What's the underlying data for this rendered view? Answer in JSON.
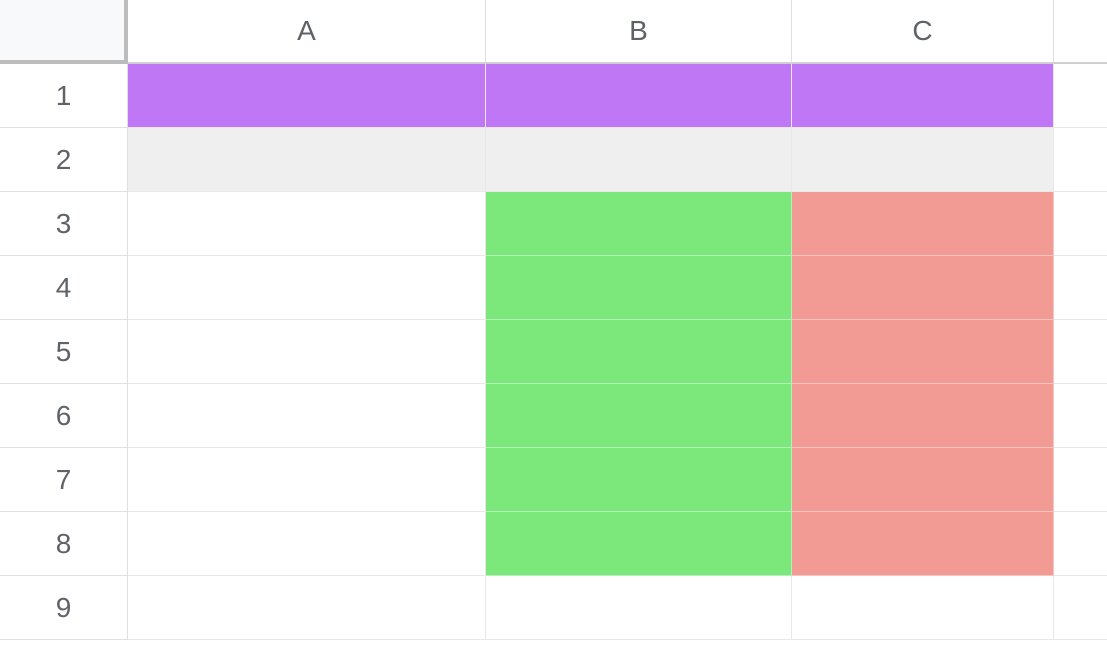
{
  "columns": [
    "A",
    "B",
    "C"
  ],
  "rows": [
    "1",
    "2",
    "3",
    "4",
    "5",
    "6",
    "7",
    "8",
    "9"
  ],
  "fills": {
    "purple": "#bf77f6",
    "gray": "#efefef",
    "green": "#7ce87c",
    "red": "#f29b94"
  },
  "cell_fills": [
    {
      "row": 1,
      "cols": [
        "A",
        "B",
        "C"
      ],
      "fill": "purple"
    },
    {
      "row": 2,
      "cols": [
        "A",
        "B",
        "C"
      ],
      "fill": "gray"
    },
    {
      "row": 3,
      "cols": [
        "B"
      ],
      "fill": "green"
    },
    {
      "row": 3,
      "cols": [
        "C"
      ],
      "fill": "red"
    },
    {
      "row": 4,
      "cols": [
        "B"
      ],
      "fill": "green"
    },
    {
      "row": 4,
      "cols": [
        "C"
      ],
      "fill": "red"
    },
    {
      "row": 5,
      "cols": [
        "B"
      ],
      "fill": "green"
    },
    {
      "row": 5,
      "cols": [
        "C"
      ],
      "fill": "red"
    },
    {
      "row": 6,
      "cols": [
        "B"
      ],
      "fill": "green"
    },
    {
      "row": 6,
      "cols": [
        "C"
      ],
      "fill": "red"
    },
    {
      "row": 7,
      "cols": [
        "B"
      ],
      "fill": "green"
    },
    {
      "row": 7,
      "cols": [
        "C"
      ],
      "fill": "red"
    },
    {
      "row": 8,
      "cols": [
        "B"
      ],
      "fill": "green"
    },
    {
      "row": 8,
      "cols": [
        "C"
      ],
      "fill": "red"
    }
  ],
  "cell_values": {}
}
